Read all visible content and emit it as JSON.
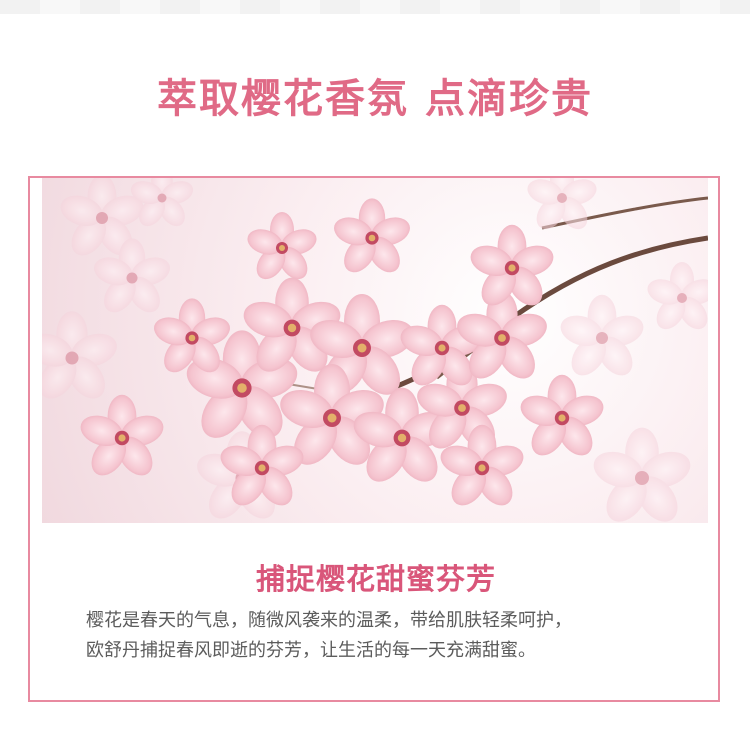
{
  "page": {
    "headline": "萃取樱花香氛 点滴珍贵",
    "card": {
      "image_alt": "cherry-blossom-photo",
      "subhead": "捕捉樱花甜蜜芬芳",
      "body_lines": [
        "樱花是春天的气息，随微风袭来的温柔，带给肌肤轻柔呵护，",
        "欧舒丹捕捉春风即逝的芬芳，让生活的每一天充满甜蜜。"
      ]
    },
    "colors": {
      "accent": "#e06a86",
      "frame": "#e88aa0",
      "body_text": "#5c5c5c"
    }
  }
}
